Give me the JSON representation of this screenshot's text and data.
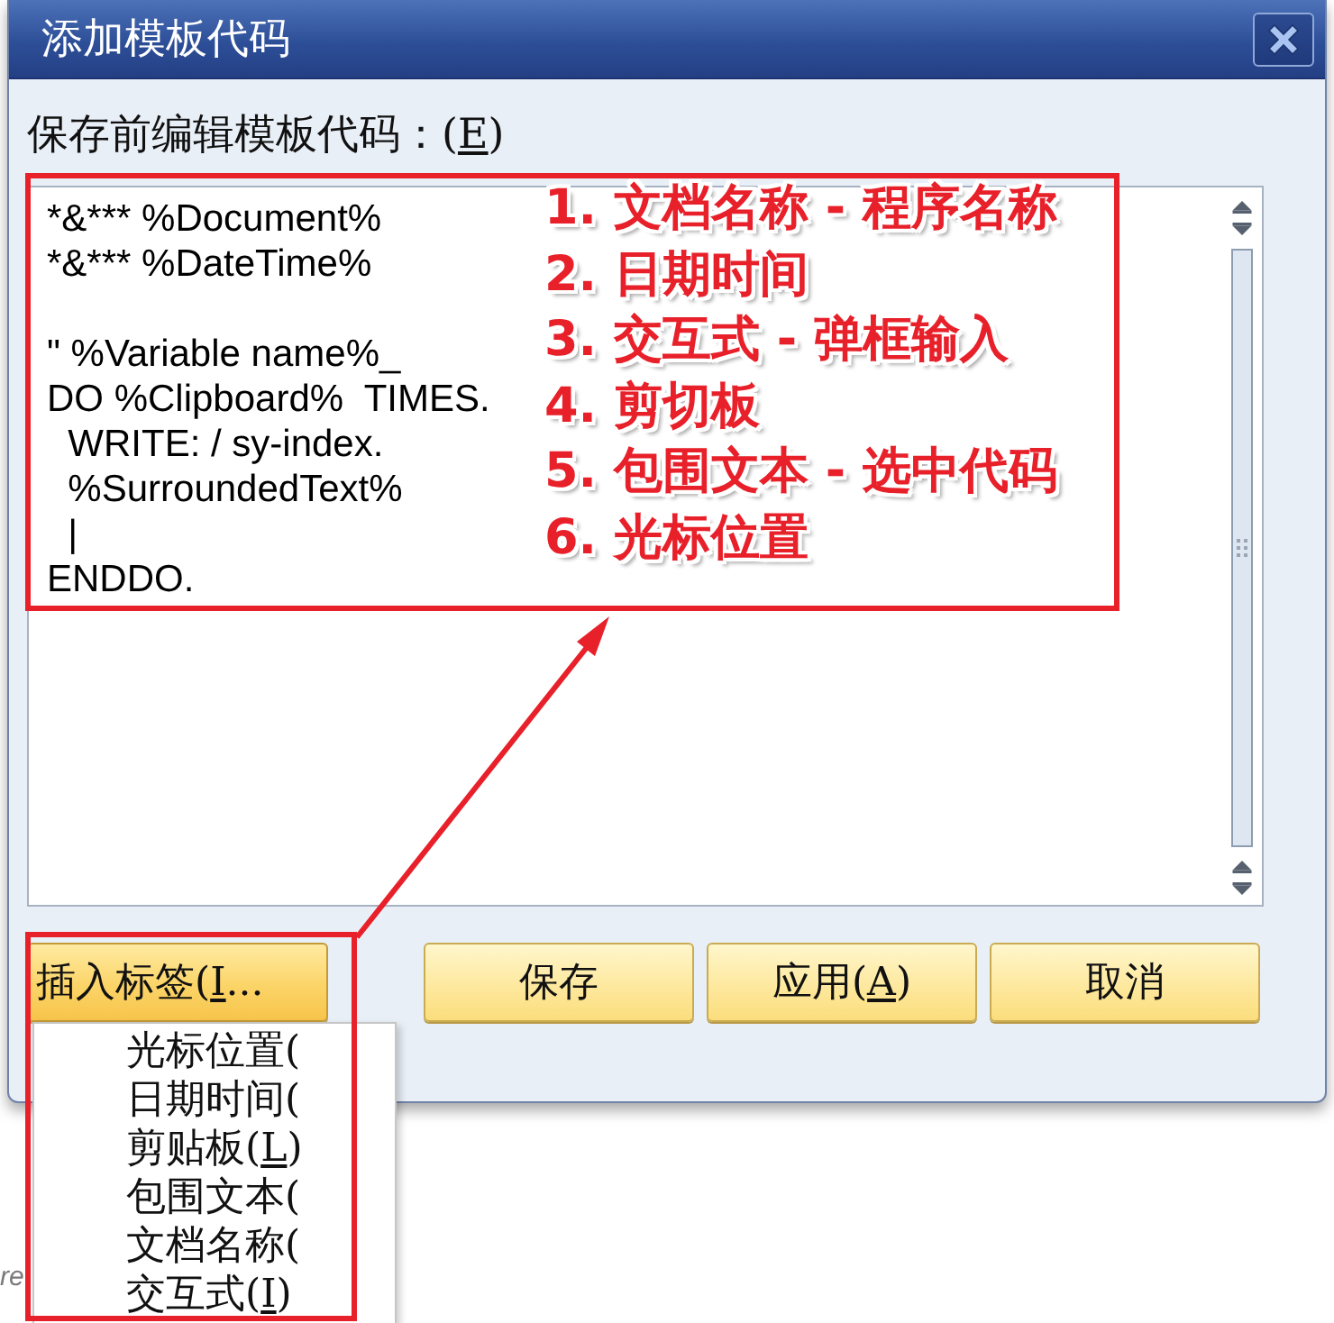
{
  "window": {
    "title": "添加模板代码"
  },
  "editor": {
    "label": {
      "text": "保存前编辑模板代码：(",
      "mnemonic": "E",
      "suffix": ")"
    },
    "code": "*&*** %Document%\n*&*** %DateTime%\n\n\" %Variable name%_\nDO %Clipboard%  TIMES.\n  WRITE: / sy-index.\n  %SurroundedText%\n  |\nENDDO."
  },
  "buttons": [
    {
      "text": "插入标签(",
      "mnemonic": "I",
      "suffix": "...",
      "pressed": true
    },
    {
      "text": "保存",
      "pressed": false
    },
    {
      "text": "应用(",
      "mnemonic": "A",
      "suffix": ")",
      "pressed": false
    },
    {
      "text": "取消",
      "pressed": false
    }
  ],
  "insert_menu": {
    "items": [
      {
        "text": "光标位置("
      },
      {
        "text": "日期时间("
      },
      {
        "text": "剪贴板(",
        "mnemonic": "L",
        "suffix": ")"
      },
      {
        "text": "包围文本("
      },
      {
        "text": "文档名称("
      },
      {
        "text": "交互式(",
        "mnemonic": "I",
        "suffix": ")"
      }
    ]
  },
  "annotations": {
    "notes": [
      "1. 文档名称 - 程序名称",
      "2. 日期时间",
      "3. 交互式 - 弹框输入",
      "4. 剪切板",
      "5. 包围文本 - 选中代码",
      "6. 光标位置"
    ]
  },
  "background_page": {
    "text": "re"
  }
}
